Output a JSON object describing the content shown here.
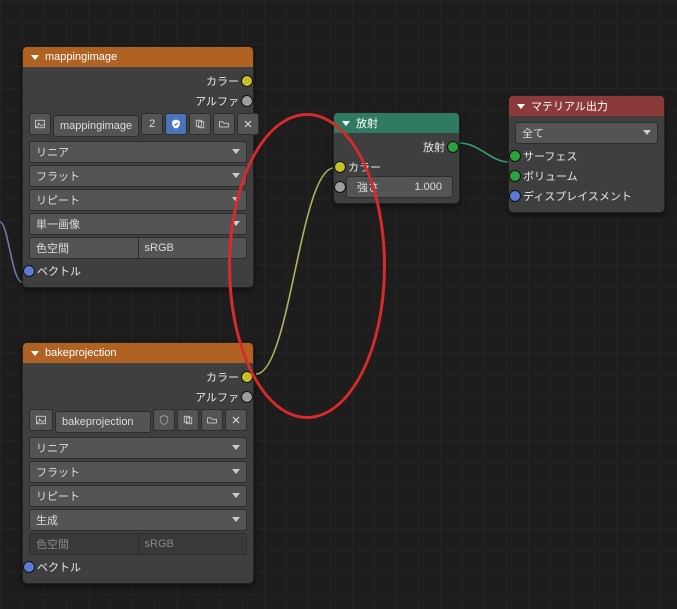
{
  "node1": {
    "title": "mappingimage",
    "out_color": "カラー",
    "out_alpha": "アルファ",
    "image_name": "mappingimage",
    "users": "2",
    "interp": "リニア",
    "projection": "フラット",
    "extension": "リピート",
    "source": "単一画像",
    "cs_label": "色空間",
    "cs_value": "sRGB",
    "in_vector": "ベクトル"
  },
  "node2": {
    "title": "bakeprojection",
    "out_color": "カラー",
    "out_alpha": "アルファ",
    "image_name": "bakeprojection",
    "interp": "リニア",
    "projection": "フラット",
    "extension": "リピート",
    "source": "生成",
    "cs_label": "色空間",
    "cs_value": "sRGB",
    "in_vector": "ベクトル"
  },
  "emission": {
    "title": "放射",
    "out": "放射",
    "in_color": "カラー",
    "in_strength_label": "強さ",
    "in_strength_value": "1.000"
  },
  "output": {
    "title": "マテリアル出力",
    "target": "全て",
    "surface": "サーフェス",
    "volume": "ボリューム",
    "displacement": "ディスプレイスメント"
  }
}
